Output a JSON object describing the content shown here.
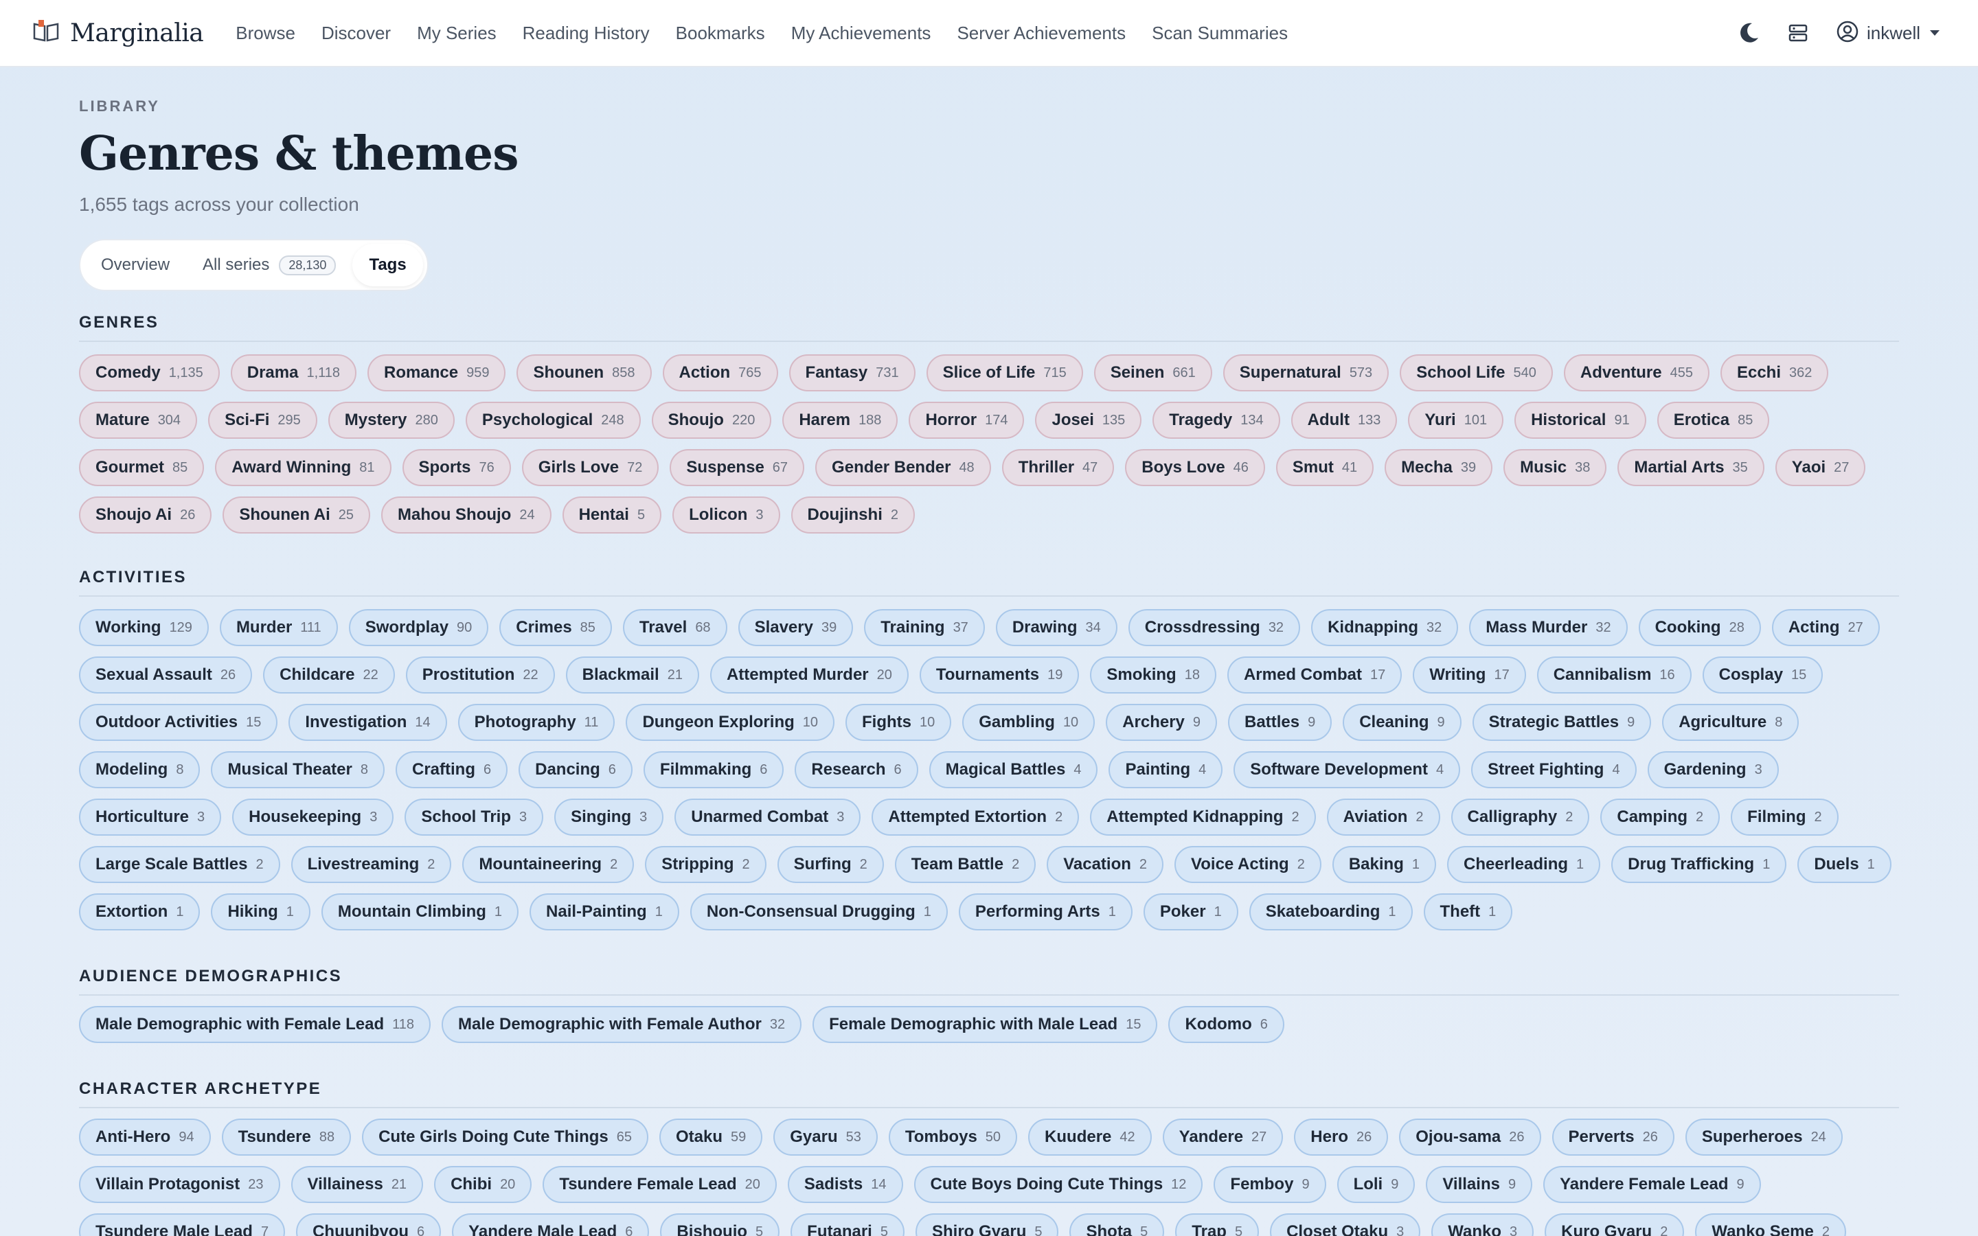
{
  "app": {
    "brand": "Marginalia"
  },
  "nav": [
    {
      "label": "Browse"
    },
    {
      "label": "Discover"
    },
    {
      "label": "My Series"
    },
    {
      "label": "Reading History"
    },
    {
      "label": "Bookmarks"
    },
    {
      "label": "My Achievements"
    },
    {
      "label": "Server Achievements"
    },
    {
      "label": "Scan Summaries"
    }
  ],
  "user": {
    "name": "inkwell"
  },
  "page": {
    "eyebrow": "LIBRARY",
    "title": "Genres & themes",
    "subtitle": "1,655 tags across your collection"
  },
  "tabs": {
    "overview": "Overview",
    "all_series": "All series",
    "all_series_count": "28,130",
    "tags": "Tags"
  },
  "sections": [
    {
      "title": "GENRES",
      "style": "genre",
      "tags": [
        {
          "n": "Comedy",
          "c": "1,135"
        },
        {
          "n": "Drama",
          "c": "1,118"
        },
        {
          "n": "Romance",
          "c": "959"
        },
        {
          "n": "Shounen",
          "c": "858"
        },
        {
          "n": "Action",
          "c": "765"
        },
        {
          "n": "Fantasy",
          "c": "731"
        },
        {
          "n": "Slice of Life",
          "c": "715"
        },
        {
          "n": "Seinen",
          "c": "661"
        },
        {
          "n": "Supernatural",
          "c": "573"
        },
        {
          "n": "School Life",
          "c": "540"
        },
        {
          "n": "Adventure",
          "c": "455"
        },
        {
          "n": "Ecchi",
          "c": "362"
        },
        {
          "n": "Mature",
          "c": "304"
        },
        {
          "n": "Sci-Fi",
          "c": "295"
        },
        {
          "n": "Mystery",
          "c": "280"
        },
        {
          "n": "Psychological",
          "c": "248"
        },
        {
          "n": "Shoujo",
          "c": "220"
        },
        {
          "n": "Harem",
          "c": "188"
        },
        {
          "n": "Horror",
          "c": "174"
        },
        {
          "n": "Josei",
          "c": "135"
        },
        {
          "n": "Tragedy",
          "c": "134"
        },
        {
          "n": "Adult",
          "c": "133"
        },
        {
          "n": "Yuri",
          "c": "101"
        },
        {
          "n": "Historical",
          "c": "91"
        },
        {
          "n": "Erotica",
          "c": "85"
        },
        {
          "n": "Gourmet",
          "c": "85"
        },
        {
          "n": "Award Winning",
          "c": "81"
        },
        {
          "n": "Sports",
          "c": "76"
        },
        {
          "n": "Girls Love",
          "c": "72"
        },
        {
          "n": "Suspense",
          "c": "67"
        },
        {
          "n": "Gender Bender",
          "c": "48"
        },
        {
          "n": "Thriller",
          "c": "47"
        },
        {
          "n": "Boys Love",
          "c": "46"
        },
        {
          "n": "Smut",
          "c": "41"
        },
        {
          "n": "Mecha",
          "c": "39"
        },
        {
          "n": "Music",
          "c": "38"
        },
        {
          "n": "Martial Arts",
          "c": "35"
        },
        {
          "n": "Yaoi",
          "c": "27"
        },
        {
          "n": "Shoujo Ai",
          "c": "26"
        },
        {
          "n": "Shounen Ai",
          "c": "25"
        },
        {
          "n": "Mahou Shoujo",
          "c": "24"
        },
        {
          "n": "Hentai",
          "c": "5"
        },
        {
          "n": "Lolicon",
          "c": "3"
        },
        {
          "n": "Doujinshi",
          "c": "2"
        }
      ]
    },
    {
      "title": "ACTIVITIES",
      "style": "blue",
      "tags": [
        {
          "n": "Working",
          "c": "129"
        },
        {
          "n": "Murder",
          "c": "111"
        },
        {
          "n": "Swordplay",
          "c": "90"
        },
        {
          "n": "Crimes",
          "c": "85"
        },
        {
          "n": "Travel",
          "c": "68"
        },
        {
          "n": "Slavery",
          "c": "39"
        },
        {
          "n": "Training",
          "c": "37"
        },
        {
          "n": "Drawing",
          "c": "34"
        },
        {
          "n": "Crossdressing",
          "c": "32"
        },
        {
          "n": "Kidnapping",
          "c": "32"
        },
        {
          "n": "Mass Murder",
          "c": "32"
        },
        {
          "n": "Cooking",
          "c": "28"
        },
        {
          "n": "Acting",
          "c": "27"
        },
        {
          "n": "Sexual Assault",
          "c": "26"
        },
        {
          "n": "Childcare",
          "c": "22"
        },
        {
          "n": "Prostitution",
          "c": "22"
        },
        {
          "n": "Blackmail",
          "c": "21"
        },
        {
          "n": "Attempted Murder",
          "c": "20"
        },
        {
          "n": "Tournaments",
          "c": "19"
        },
        {
          "n": "Smoking",
          "c": "18"
        },
        {
          "n": "Armed Combat",
          "c": "17"
        },
        {
          "n": "Writing",
          "c": "17"
        },
        {
          "n": "Cannibalism",
          "c": "16"
        },
        {
          "n": "Cosplay",
          "c": "15"
        },
        {
          "n": "Outdoor Activities",
          "c": "15"
        },
        {
          "n": "Investigation",
          "c": "14"
        },
        {
          "n": "Photography",
          "c": "11"
        },
        {
          "n": "Dungeon Exploring",
          "c": "10"
        },
        {
          "n": "Fights",
          "c": "10"
        },
        {
          "n": "Gambling",
          "c": "10"
        },
        {
          "n": "Archery",
          "c": "9"
        },
        {
          "n": "Battles",
          "c": "9"
        },
        {
          "n": "Cleaning",
          "c": "9"
        },
        {
          "n": "Strategic Battles",
          "c": "9"
        },
        {
          "n": "Agriculture",
          "c": "8"
        },
        {
          "n": "Modeling",
          "c": "8"
        },
        {
          "n": "Musical Theater",
          "c": "8"
        },
        {
          "n": "Crafting",
          "c": "6"
        },
        {
          "n": "Dancing",
          "c": "6"
        },
        {
          "n": "Filmmaking",
          "c": "6"
        },
        {
          "n": "Research",
          "c": "6"
        },
        {
          "n": "Magical Battles",
          "c": "4"
        },
        {
          "n": "Painting",
          "c": "4"
        },
        {
          "n": "Software Development",
          "c": "4"
        },
        {
          "n": "Street Fighting",
          "c": "4"
        },
        {
          "n": "Gardening",
          "c": "3"
        },
        {
          "n": "Horticulture",
          "c": "3"
        },
        {
          "n": "Housekeeping",
          "c": "3"
        },
        {
          "n": "School Trip",
          "c": "3"
        },
        {
          "n": "Singing",
          "c": "3"
        },
        {
          "n": "Unarmed Combat",
          "c": "3"
        },
        {
          "n": "Attempted Extortion",
          "c": "2"
        },
        {
          "n": "Attempted Kidnapping",
          "c": "2"
        },
        {
          "n": "Aviation",
          "c": "2"
        },
        {
          "n": "Calligraphy",
          "c": "2"
        },
        {
          "n": "Camping",
          "c": "2"
        },
        {
          "n": "Filming",
          "c": "2"
        },
        {
          "n": "Large Scale Battles",
          "c": "2"
        },
        {
          "n": "Livestreaming",
          "c": "2"
        },
        {
          "n": "Mountaineering",
          "c": "2"
        },
        {
          "n": "Stripping",
          "c": "2"
        },
        {
          "n": "Surfing",
          "c": "2"
        },
        {
          "n": "Team Battle",
          "c": "2"
        },
        {
          "n": "Vacation",
          "c": "2"
        },
        {
          "n": "Voice Acting",
          "c": "2"
        },
        {
          "n": "Baking",
          "c": "1"
        },
        {
          "n": "Cheerleading",
          "c": "1"
        },
        {
          "n": "Drug Trafficking",
          "c": "1"
        },
        {
          "n": "Duels",
          "c": "1"
        },
        {
          "n": "Extortion",
          "c": "1"
        },
        {
          "n": "Hiking",
          "c": "1"
        },
        {
          "n": "Mountain Climbing",
          "c": "1"
        },
        {
          "n": "Nail-Painting",
          "c": "1"
        },
        {
          "n": "Non-Consensual Drugging",
          "c": "1"
        },
        {
          "n": "Performing Arts",
          "c": "1"
        },
        {
          "n": "Poker",
          "c": "1"
        },
        {
          "n": "Skateboarding",
          "c": "1"
        },
        {
          "n": "Theft",
          "c": "1"
        }
      ]
    },
    {
      "title": "AUDIENCE DEMOGRAPHICS",
      "style": "blue",
      "tags": [
        {
          "n": "Male Demographic with Female Lead",
          "c": "118"
        },
        {
          "n": "Male Demographic with Female Author",
          "c": "32"
        },
        {
          "n": "Female Demographic with Male Lead",
          "c": "15"
        },
        {
          "n": "Kodomo",
          "c": "6"
        }
      ]
    },
    {
      "title": "CHARACTER ARCHETYPE",
      "style": "blue",
      "tags": [
        {
          "n": "Anti-Hero",
          "c": "94"
        },
        {
          "n": "Tsundere",
          "c": "88"
        },
        {
          "n": "Cute Girls Doing Cute Things",
          "c": "65"
        },
        {
          "n": "Otaku",
          "c": "59"
        },
        {
          "n": "Gyaru",
          "c": "53"
        },
        {
          "n": "Tomboys",
          "c": "50"
        },
        {
          "n": "Kuudere",
          "c": "42"
        },
        {
          "n": "Yandere",
          "c": "27"
        },
        {
          "n": "Hero",
          "c": "26"
        },
        {
          "n": "Ojou-sama",
          "c": "26"
        },
        {
          "n": "Perverts",
          "c": "26"
        },
        {
          "n": "Superheroes",
          "c": "24"
        },
        {
          "n": "Villain Protagonist",
          "c": "23"
        },
        {
          "n": "Villainess",
          "c": "21"
        },
        {
          "n": "Chibi",
          "c": "20"
        },
        {
          "n": "Tsundere Female Lead",
          "c": "20"
        },
        {
          "n": "Sadists",
          "c": "14"
        },
        {
          "n": "Cute Boys Doing Cute Things",
          "c": "12"
        },
        {
          "n": "Femboy",
          "c": "9"
        },
        {
          "n": "Loli",
          "c": "9"
        },
        {
          "n": "Villains",
          "c": "9"
        },
        {
          "n": "Yandere Female Lead",
          "c": "9"
        },
        {
          "n": "Tsundere Male Lead",
          "c": "7"
        },
        {
          "n": "Chuunibyou",
          "c": "6"
        },
        {
          "n": "Yandere Male Lead",
          "c": "6"
        },
        {
          "n": "Bishoujo",
          "c": "5"
        },
        {
          "n": "Futanari",
          "c": "5"
        },
        {
          "n": "Shiro Gyaru",
          "c": "5"
        },
        {
          "n": "Shota",
          "c": "5"
        },
        {
          "n": "Trap",
          "c": "5"
        },
        {
          "n": "Closet Otaku",
          "c": "3"
        },
        {
          "n": "Wanko",
          "c": "3"
        },
        {
          "n": "Kuro Gyaru",
          "c": "2"
        },
        {
          "n": "Wanko Seme",
          "c": "2"
        }
      ]
    }
  ]
}
